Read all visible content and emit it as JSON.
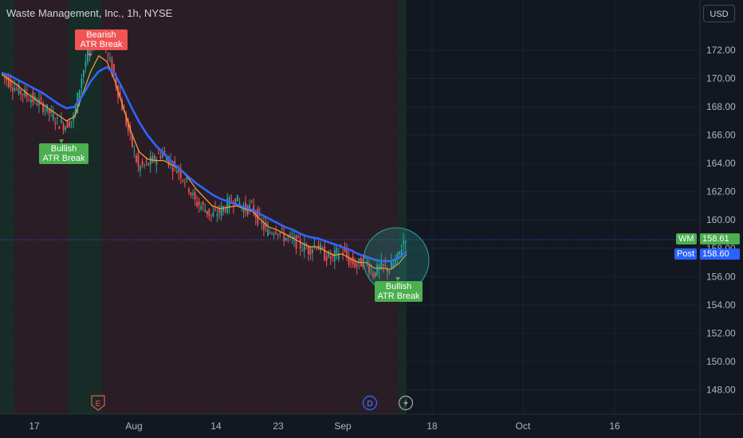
{
  "header": {
    "title": "Waste Management, Inc., 1h, NYSE",
    "currency": "USD"
  },
  "colors": {
    "background": "#131722",
    "bearish_zone": "#2b1d26",
    "bullish_zone": "#172c26",
    "ma_fast": "#f29b38",
    "ma_slow": "#2e66ff",
    "candle_up": "#26a69a",
    "candle_down": "#ef5350",
    "signal_bull": "#4caf50",
    "signal_bear": "#f05454",
    "post": "#2962ff"
  },
  "price_tags": {
    "last_symbol": "WM",
    "last_price": "158.61",
    "post_label": "Post",
    "post_price": "158.60"
  },
  "chart_data": {
    "type": "candlestick",
    "title": "Waste Management, Inc., 1h, NYSE",
    "x_ticks": [
      "17",
      "Aug",
      "14",
      "23",
      "Sep",
      "18",
      "Oct",
      "16"
    ],
    "y_ticks": [
      "148.00",
      "150.00",
      "152.00",
      "154.00",
      "156.00",
      "158.00",
      "160.00",
      "162.00",
      "164.00",
      "166.00",
      "168.00",
      "170.00",
      "172.00"
    ],
    "ylim": [
      146.5,
      173.8
    ],
    "close_path": [
      170.4,
      169.8,
      169.2,
      168.9,
      168.5,
      168.2,
      167.6,
      166.9,
      166.7,
      167.2,
      170.1,
      172.3,
      173.0,
      172.0,
      170.2,
      168.0,
      165.8,
      163.7,
      163.9,
      164.3,
      164.8,
      164.0,
      163.5,
      162.6,
      161.3,
      160.9,
      160.3,
      160.6,
      161.1,
      161.5,
      160.8,
      160.9,
      159.9,
      159.1,
      159.4,
      158.8,
      158.6,
      158.2,
      157.9,
      158.3,
      157.5,
      157.3,
      158.0,
      157.1,
      156.8,
      157.2,
      156.2,
      156.7,
      156.5,
      157.3,
      158.9
    ],
    "ma_fast": [
      170.3,
      169.9,
      169.5,
      169.0,
      168.6,
      168.2,
      167.8,
      167.4,
      167.0,
      167.3,
      168.9,
      170.5,
      171.6,
      171.2,
      169.8,
      168.0,
      166.2,
      164.8,
      164.3,
      164.2,
      164.2,
      163.9,
      163.6,
      163.0,
      162.2,
      161.6,
      161.0,
      160.8,
      160.9,
      161.0,
      160.8,
      160.6,
      160.0,
      159.5,
      159.3,
      159.0,
      158.7,
      158.4,
      158.1,
      158.1,
      157.8,
      157.5,
      157.6,
      157.3,
      157.0,
      157.0,
      156.6,
      156.6,
      156.5,
      156.9,
      157.6
    ],
    "ma_slow": [
      170.4,
      170.2,
      169.9,
      169.6,
      169.3,
      169.0,
      168.6,
      168.2,
      167.9,
      168.0,
      168.8,
      169.8,
      170.5,
      170.8,
      170.3,
      169.2,
      168.0,
      166.9,
      166.0,
      165.3,
      164.7,
      164.1,
      163.6,
      163.1,
      162.6,
      162.2,
      161.8,
      161.5,
      161.3,
      161.1,
      160.9,
      160.7,
      160.4,
      160.1,
      159.8,
      159.5,
      159.3,
      159.0,
      158.8,
      158.7,
      158.5,
      158.3,
      158.1,
      157.9,
      157.6,
      157.4,
      157.2,
      157.1,
      157.1,
      157.3,
      157.8
    ],
    "signals": [
      {
        "type": "bearish",
        "text1": "Bearish",
        "text2": "ATR Break",
        "at_price": 172.7
      },
      {
        "type": "bullish",
        "text1": "Bullish",
        "text2": "ATR Break",
        "at_price": 166.3
      },
      {
        "type": "bullish",
        "text1": "Bullish",
        "text2": "ATR Break",
        "at_price": 155.9
      }
    ],
    "markers": [
      "E",
      "D"
    ],
    "last_price": 158.61,
    "post_price": 158.6
  }
}
